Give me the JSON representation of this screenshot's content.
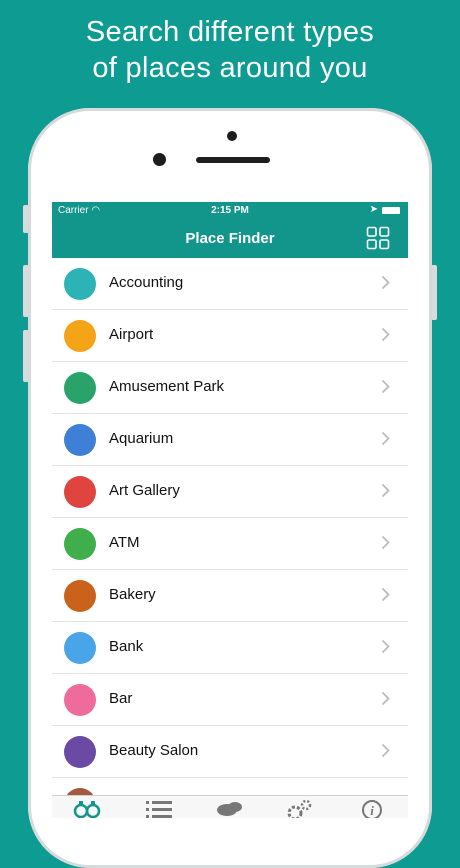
{
  "headline": {
    "line1": "Search different types",
    "line2": "of places around you"
  },
  "status_bar": {
    "carrier": "Carrier",
    "time": "2:15 PM"
  },
  "nav": {
    "title": "Place Finder"
  },
  "colors": {
    "background": "#0e9b91",
    "nav": "#12958b"
  },
  "places": [
    {
      "label": "Accounting",
      "icon": "accounting-icon",
      "color": "#2bb3b5"
    },
    {
      "label": "Airport",
      "icon": "airplane-icon",
      "color": "#f5a417"
    },
    {
      "label": "Amusement Park",
      "icon": "carousel-horse-icon",
      "color": "#2aa36a"
    },
    {
      "label": "Aquarium",
      "icon": "dolphin-icon",
      "color": "#3f7fd6"
    },
    {
      "label": "Art Gallery",
      "icon": "palette-icon",
      "color": "#e0443f"
    },
    {
      "label": "ATM",
      "icon": "atm-icon",
      "color": "#3fae4b"
    },
    {
      "label": "Bakery",
      "icon": "cupcake-icon",
      "color": "#c9621a"
    },
    {
      "label": "Bank",
      "icon": "bank-icon",
      "color": "#4aa4e8"
    },
    {
      "label": "Bar",
      "icon": "wine-glass-icon",
      "color": "#ef6b9c"
    },
    {
      "label": "Beauty Salon",
      "icon": "scissors-icon",
      "color": "#6b4aa3"
    },
    {
      "label": "",
      "icon": "partial-icon",
      "color": "#a35a3e"
    }
  ],
  "tabs": [
    {
      "name": "binoculars-tab-icon"
    },
    {
      "name": "list-tab-icon"
    },
    {
      "name": "chat-tab-icon"
    },
    {
      "name": "settings-tab-icon"
    },
    {
      "name": "info-tab-icon"
    }
  ]
}
